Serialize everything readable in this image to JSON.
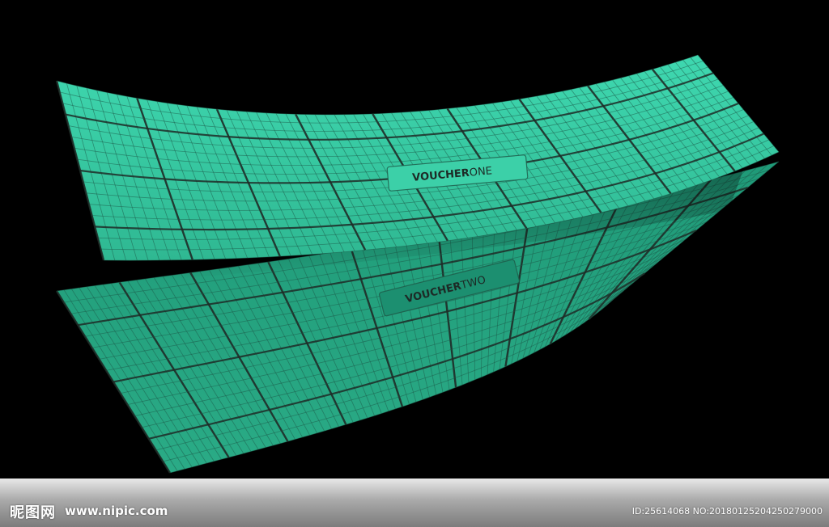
{
  "colors": {
    "background": "#000000",
    "voucher_one_top": "#3fd8b0",
    "voucher_one_bottom": "#2fb892",
    "voucher_two_top": "#1f9a78",
    "voucher_two_bottom": "#2aab86",
    "grid_line": "#1d5a48",
    "grid_major": "#1f2b27"
  },
  "voucher_one": {
    "label_bold": "VOUCHER",
    "label_light": "ONE"
  },
  "voucher_two": {
    "label_bold": "VOUCHER",
    "label_light": "TWO"
  },
  "footer": {
    "logo": "昵图网",
    "url": "www.nipic.com",
    "image_id": "ID:25614068 NO:20180125204250279000"
  }
}
